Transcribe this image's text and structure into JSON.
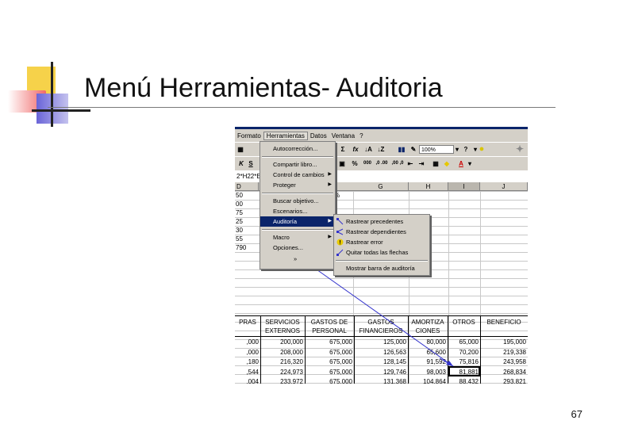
{
  "slide": {
    "title": "Menú Herramientas- Auditoria",
    "page_number": "67"
  },
  "menubar": {
    "items": [
      "Formato",
      "Herramientas",
      "Datos",
      "Ventana",
      "?"
    ]
  },
  "toolbar": {
    "zoom": "100%",
    "format_percent": "%",
    "format_thousands": "000",
    "format_dec_up": ",0 .00",
    "format_dec_down": ",00 ,0"
  },
  "formula_bar": {
    "content": "2*H22*E"
  },
  "col_headers": [
    "D",
    "G",
    "H",
    "I",
    "J"
  ],
  "col_d_values": [
    "50",
    "00",
    "75",
    "25",
    "30",
    "55",
    "790"
  ],
  "pct_symbol": "%",
  "tools_menu": {
    "items": [
      "Autocorrección...",
      "Compartir libro...",
      "Control de cambios",
      "Proteger",
      "Buscar objetivo...",
      "Escenarios...",
      "Auditoría",
      "Macro",
      "Opciones..."
    ],
    "more": "»"
  },
  "audit_submenu": {
    "items": [
      "Rastrear precedentes",
      "Rastrear dependientes",
      "Rastrear error",
      "Quitar todas las flechas",
      "Mostrar barra de auditoría"
    ]
  },
  "table": {
    "headers": [
      [
        "PRAS",
        ""
      ],
      [
        "SERVICIOS",
        "EXTERNOS"
      ],
      [
        "GASTOS DE",
        "PERSONAL"
      ],
      [
        "GASTOS",
        "FINANCIEROS"
      ],
      [
        "AMORTIZA",
        "CIONES"
      ],
      [
        "OTROS",
        ""
      ],
      [
        "BENEFICIO",
        ""
      ]
    ],
    "rows": [
      [
        ",000",
        "200,000",
        "675,000",
        "125,000",
        "80,000",
        "65,000",
        "195,000"
      ],
      [
        ",000",
        "208,000",
        "675,000",
        "126,563",
        "65,600",
        "70,200",
        "219,338"
      ],
      [
        ",180",
        "216,320",
        "675,000",
        "128,145",
        "91,592",
        "75,816",
        "243,958"
      ],
      [
        ",544",
        "224,973",
        "675,000",
        "129,746",
        "98,003",
        "81,881",
        "268,834"
      ],
      [
        ",004",
        "233,972",
        "675,000",
        "131,368",
        "104,864",
        "88,432",
        "293,821"
      ]
    ]
  },
  "colors": {
    "menu_bg": "#d4d0c8",
    "highlight": "#0a246a",
    "arrow": "#3333cc"
  }
}
